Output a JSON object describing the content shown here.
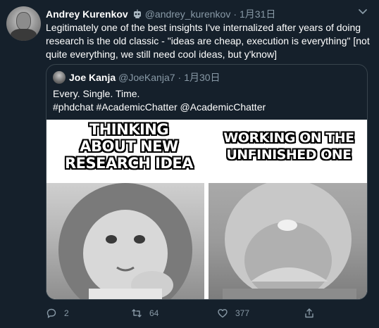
{
  "tweet": {
    "author_name": "Andrey Kurenkov",
    "author_handle": "@andrey_kurenkov",
    "separator": "·",
    "date": "1月31日",
    "text": "Legitimately one of the best insights I've internalized after years of doing research is the old classic - \"ideas are cheap, execution is everything\" [not quite everything, we still need cool ideas, but y'know]",
    "badge_icon": "robot-icon",
    "menu_icon": "chevron-down-icon"
  },
  "quote": {
    "author_name": "Joe Kanja",
    "author_handle": "@JoeKanja7",
    "separator": "·",
    "date": "1月30日",
    "line1": "Every. Single. Time.",
    "line2": "#phdchat #AcademicChatter @AcademicChatter",
    "meme": {
      "caption_left": "THINKING ABOUT NEW RESEARCH IDEA",
      "caption_right": "WORKING ON THE UNFINISHED ONE"
    }
  },
  "actions": {
    "reply_count": "2",
    "retweet_count": "64",
    "like_count": "377",
    "reply_icon": "reply-icon",
    "retweet_icon": "retweet-icon",
    "like_icon": "heart-icon",
    "share_icon": "share-icon"
  },
  "colors": {
    "background": "#15202b",
    "secondary_text": "#8899a6",
    "border": "#38444d"
  }
}
